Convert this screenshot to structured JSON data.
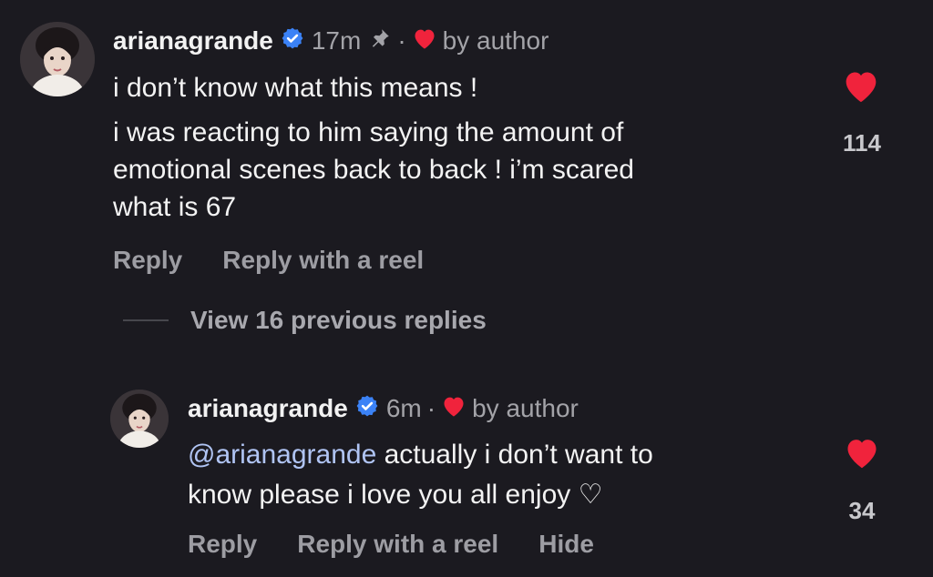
{
  "comment": {
    "username": "arianagrande",
    "time": "17m",
    "author_label": "by author",
    "lines": [
      "i don’t know what this means !",
      "i was reacting to him saying the amount of",
      "emotional scenes back to back ! i’m scared",
      "what is 67"
    ],
    "actions": [
      "Reply",
      "Reply with a reel"
    ],
    "likes": "114"
  },
  "view_replies": "View 16 previous replies",
  "reply": {
    "username": "arianagrande",
    "time": "6m",
    "author_label": "by author",
    "mention": "@arianagrande",
    "line1_rest": " actually i don’t want to",
    "line2": "know please i love you all enjoy ♡",
    "actions": [
      "Reply",
      "Reply with a reel",
      "Hide"
    ],
    "likes": "34"
  },
  "colors": {
    "background": "#1b1a20",
    "heart": "#f0233c",
    "verified": "#3b82f6",
    "mention": "#b0c4f3"
  },
  "icons": [
    "verified-badge-icon",
    "pin-icon",
    "heart-icon",
    "avatar"
  ]
}
